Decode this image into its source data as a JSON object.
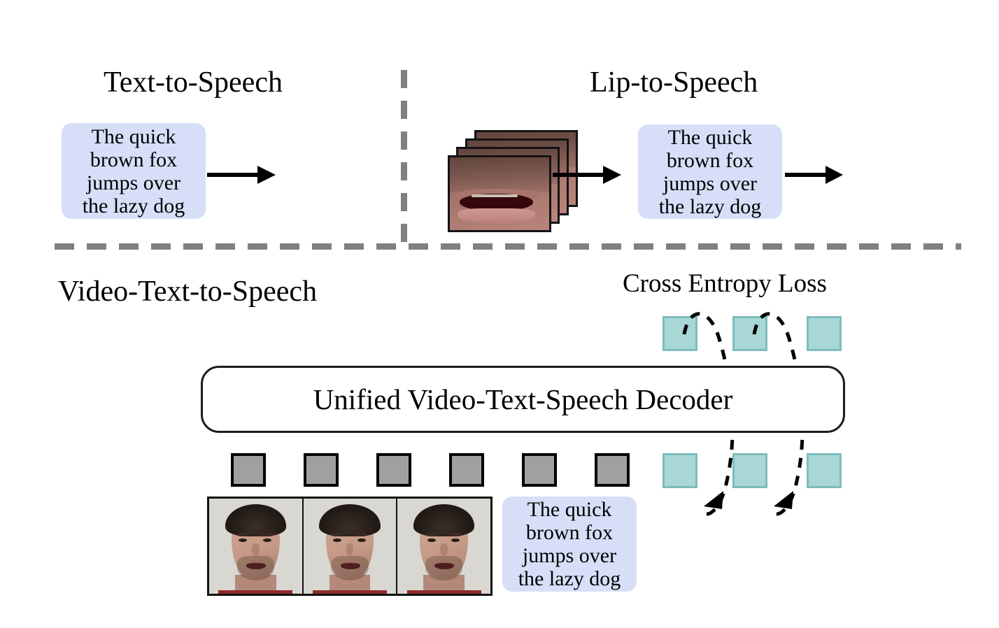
{
  "figure": {
    "title_top_left": "Text-to-Speech",
    "title_top_right": "Lip-to-Speech",
    "title_bottom": "Video-Text-to-Speech",
    "loss_label": "Cross Entropy Loss",
    "decoder_label": "Unified Video-Text-Speech Decoder",
    "prompt_text": "The quick\nbrown fox\njumps over\nthe lazy dog"
  },
  "sections": {
    "tts": {
      "name": "Text-to-Speech",
      "input": "The quick\nbrown fox\njumps over\nthe lazy dog",
      "input_type": "text",
      "output_type": "speech-waveform",
      "arrows": 1
    },
    "lts": {
      "name": "Lip-to-Speech",
      "input_type": "lip-video-frames",
      "lip_frame_count": 4,
      "intermediate": "The quick\nbrown fox\njumps over\nthe lazy dog",
      "output_type": "speech-waveform",
      "arrows": 2
    },
    "vtts": {
      "name": "Video-Text-to-Speech",
      "text_input": "The quick\nbrown fox\njumps over\nthe lazy dog",
      "face_frame_count": 3,
      "video_token_count": 6,
      "speech_token_count_bottom": 3,
      "speech_token_count_top": 3,
      "decoder": "Unified Video-Text-Speech Decoder",
      "loss": "Cross Entropy Loss",
      "loss_curve_count": 2,
      "output_type": "speech-waveform"
    }
  },
  "colors": {
    "text_bubble_bg": "#d6dff7",
    "video_token": "#a0a0a0",
    "video_token_border": "#000000",
    "speech_token": "#a9d7d6",
    "speech_token_border": "#7cbcbb",
    "divider": "#808080",
    "outline": "#000000",
    "waveform_start": "#9a3fd6",
    "waveform_end": "#86c8f0",
    "background": "#ffffff"
  },
  "icons": {
    "arrow": "arrow-right-icon",
    "loss_curve": "dashed-curve-arrow-icon",
    "waveform": "audio-waveform-icon"
  }
}
